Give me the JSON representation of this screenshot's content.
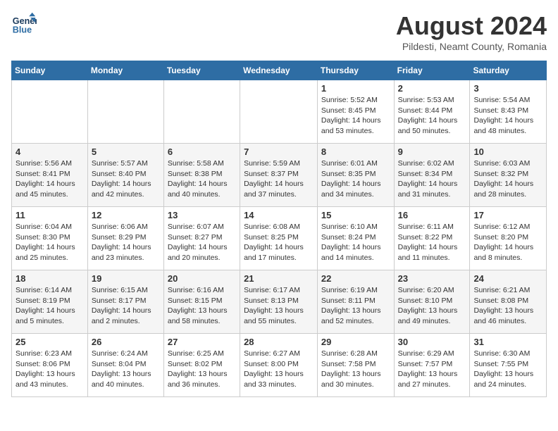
{
  "header": {
    "logo_line1": "General",
    "logo_line2": "Blue",
    "month_year": "August 2024",
    "location": "Pildesti, Neamt County, Romania"
  },
  "weekdays": [
    "Sunday",
    "Monday",
    "Tuesday",
    "Wednesday",
    "Thursday",
    "Friday",
    "Saturday"
  ],
  "weeks": [
    [
      {
        "day": "",
        "info": ""
      },
      {
        "day": "",
        "info": ""
      },
      {
        "day": "",
        "info": ""
      },
      {
        "day": "",
        "info": ""
      },
      {
        "day": "1",
        "info": "Sunrise: 5:52 AM\nSunset: 8:45 PM\nDaylight: 14 hours\nand 53 minutes."
      },
      {
        "day": "2",
        "info": "Sunrise: 5:53 AM\nSunset: 8:44 PM\nDaylight: 14 hours\nand 50 minutes."
      },
      {
        "day": "3",
        "info": "Sunrise: 5:54 AM\nSunset: 8:43 PM\nDaylight: 14 hours\nand 48 minutes."
      }
    ],
    [
      {
        "day": "4",
        "info": "Sunrise: 5:56 AM\nSunset: 8:41 PM\nDaylight: 14 hours\nand 45 minutes."
      },
      {
        "day": "5",
        "info": "Sunrise: 5:57 AM\nSunset: 8:40 PM\nDaylight: 14 hours\nand 42 minutes."
      },
      {
        "day": "6",
        "info": "Sunrise: 5:58 AM\nSunset: 8:38 PM\nDaylight: 14 hours\nand 40 minutes."
      },
      {
        "day": "7",
        "info": "Sunrise: 5:59 AM\nSunset: 8:37 PM\nDaylight: 14 hours\nand 37 minutes."
      },
      {
        "day": "8",
        "info": "Sunrise: 6:01 AM\nSunset: 8:35 PM\nDaylight: 14 hours\nand 34 minutes."
      },
      {
        "day": "9",
        "info": "Sunrise: 6:02 AM\nSunset: 8:34 PM\nDaylight: 14 hours\nand 31 minutes."
      },
      {
        "day": "10",
        "info": "Sunrise: 6:03 AM\nSunset: 8:32 PM\nDaylight: 14 hours\nand 28 minutes."
      }
    ],
    [
      {
        "day": "11",
        "info": "Sunrise: 6:04 AM\nSunset: 8:30 PM\nDaylight: 14 hours\nand 25 minutes."
      },
      {
        "day": "12",
        "info": "Sunrise: 6:06 AM\nSunset: 8:29 PM\nDaylight: 14 hours\nand 23 minutes."
      },
      {
        "day": "13",
        "info": "Sunrise: 6:07 AM\nSunset: 8:27 PM\nDaylight: 14 hours\nand 20 minutes."
      },
      {
        "day": "14",
        "info": "Sunrise: 6:08 AM\nSunset: 8:25 PM\nDaylight: 14 hours\nand 17 minutes."
      },
      {
        "day": "15",
        "info": "Sunrise: 6:10 AM\nSunset: 8:24 PM\nDaylight: 14 hours\nand 14 minutes."
      },
      {
        "day": "16",
        "info": "Sunrise: 6:11 AM\nSunset: 8:22 PM\nDaylight: 14 hours\nand 11 minutes."
      },
      {
        "day": "17",
        "info": "Sunrise: 6:12 AM\nSunset: 8:20 PM\nDaylight: 14 hours\nand 8 minutes."
      }
    ],
    [
      {
        "day": "18",
        "info": "Sunrise: 6:14 AM\nSunset: 8:19 PM\nDaylight: 14 hours\nand 5 minutes."
      },
      {
        "day": "19",
        "info": "Sunrise: 6:15 AM\nSunset: 8:17 PM\nDaylight: 14 hours\nand 2 minutes."
      },
      {
        "day": "20",
        "info": "Sunrise: 6:16 AM\nSunset: 8:15 PM\nDaylight: 13 hours\nand 58 minutes."
      },
      {
        "day": "21",
        "info": "Sunrise: 6:17 AM\nSunset: 8:13 PM\nDaylight: 13 hours\nand 55 minutes."
      },
      {
        "day": "22",
        "info": "Sunrise: 6:19 AM\nSunset: 8:11 PM\nDaylight: 13 hours\nand 52 minutes."
      },
      {
        "day": "23",
        "info": "Sunrise: 6:20 AM\nSunset: 8:10 PM\nDaylight: 13 hours\nand 49 minutes."
      },
      {
        "day": "24",
        "info": "Sunrise: 6:21 AM\nSunset: 8:08 PM\nDaylight: 13 hours\nand 46 minutes."
      }
    ],
    [
      {
        "day": "25",
        "info": "Sunrise: 6:23 AM\nSunset: 8:06 PM\nDaylight: 13 hours\nand 43 minutes."
      },
      {
        "day": "26",
        "info": "Sunrise: 6:24 AM\nSunset: 8:04 PM\nDaylight: 13 hours\nand 40 minutes."
      },
      {
        "day": "27",
        "info": "Sunrise: 6:25 AM\nSunset: 8:02 PM\nDaylight: 13 hours\nand 36 minutes."
      },
      {
        "day": "28",
        "info": "Sunrise: 6:27 AM\nSunset: 8:00 PM\nDaylight: 13 hours\nand 33 minutes."
      },
      {
        "day": "29",
        "info": "Sunrise: 6:28 AM\nSunset: 7:58 PM\nDaylight: 13 hours\nand 30 minutes."
      },
      {
        "day": "30",
        "info": "Sunrise: 6:29 AM\nSunset: 7:57 PM\nDaylight: 13 hours\nand 27 minutes."
      },
      {
        "day": "31",
        "info": "Sunrise: 6:30 AM\nSunset: 7:55 PM\nDaylight: 13 hours\nand 24 minutes."
      }
    ]
  ]
}
